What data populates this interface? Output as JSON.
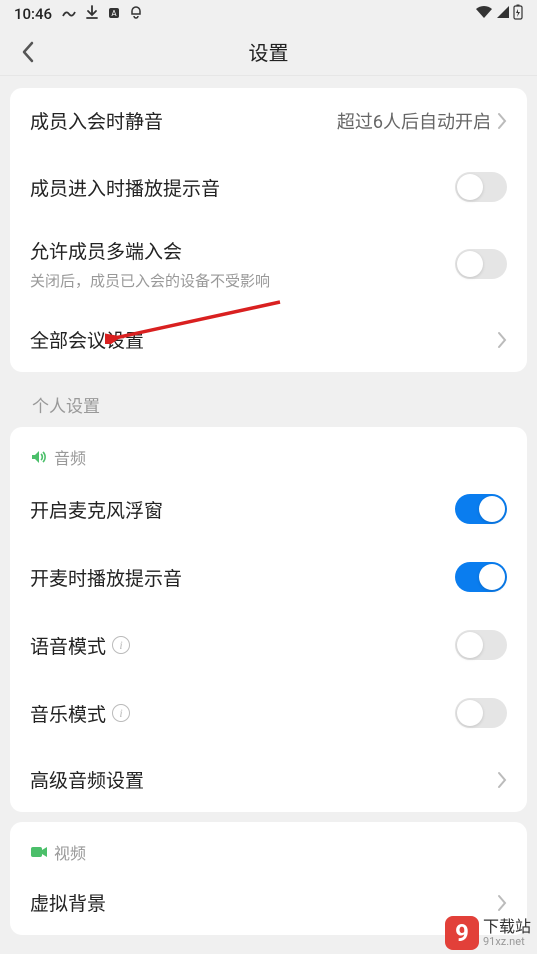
{
  "status_bar": {
    "time": "10:46",
    "icons": {
      "wave": "〰",
      "download": "⬇",
      "square": "▣",
      "notify": "◔"
    }
  },
  "nav": {
    "title": "设置"
  },
  "sections": {
    "meeting": {
      "mute_on_join": {
        "label": "成员入会时静音",
        "value": "超过6人后自动开启"
      },
      "play_sound_on_enter": {
        "label": "成员进入时播放提示音"
      },
      "multi_device": {
        "label": "允许成员多端入会",
        "sub": "关闭后，成员已入会的设备不受影响"
      },
      "all_meeting_settings": {
        "label": "全部会议设置"
      }
    },
    "personal_header": "个人设置",
    "audio": {
      "header": "音频",
      "mic_float": {
        "label": "开启麦克风浮窗"
      },
      "mic_sound": {
        "label": "开麦时播放提示音"
      },
      "voice_mode": {
        "label": "语音模式"
      },
      "music_mode": {
        "label": "音乐模式"
      },
      "advanced": {
        "label": "高级音频设置"
      }
    },
    "video": {
      "header": "视频",
      "virtual_bg": {
        "label": "虚拟背景"
      }
    }
  },
  "watermark": {
    "badge": "9",
    "cn": "下载站",
    "url": "91xz.net"
  }
}
